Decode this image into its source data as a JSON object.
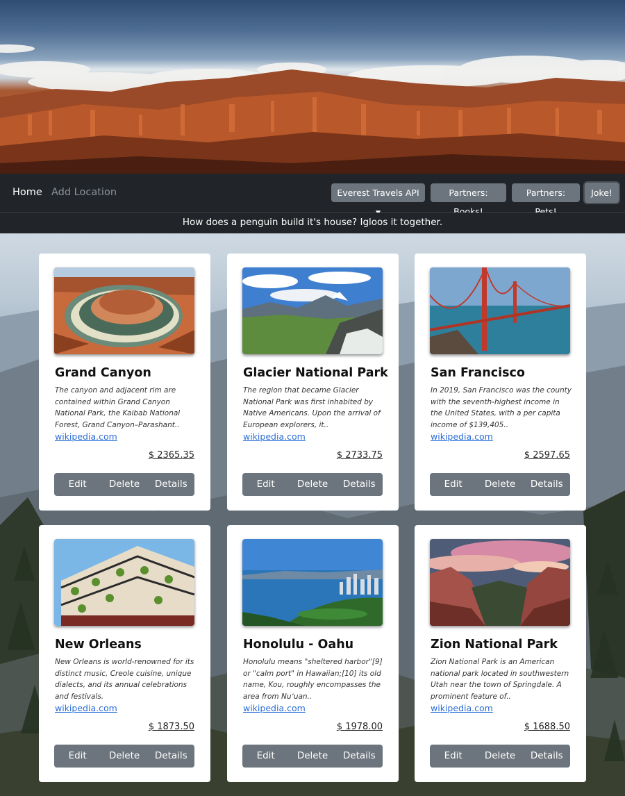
{
  "nav": {
    "home": "Home",
    "add_location": "Add Location",
    "buttons": {
      "api": "Everest Travels API",
      "books": "Partners: Books!",
      "pets": "Partners: Pets!",
      "joke": "Joke!"
    }
  },
  "joke": "How does a penguin build it's house? Igloos it together.",
  "actions": {
    "edit": "Edit",
    "delete": "Delete",
    "details": "Details"
  },
  "cards": [
    {
      "title": "Grand Canyon",
      "description": "The canyon and adjacent rim are contained within Grand Canyon National Park, the Kaibab National Forest, Grand Canyon–Parashant..",
      "link": "wikipedia.com",
      "price": "$ 2365.35"
    },
    {
      "title": "Glacier National Park",
      "description": "The region that became Glacier National Park was first inhabited by Native Americans. Upon the arrival of European explorers, it..",
      "link": "wikipedia.com",
      "price": "$ 2733.75"
    },
    {
      "title": "San Francisco",
      "description": "In 2019, San Francisco was the county with the seventh-highest income in the United States, with a per capita income of $139,405..",
      "link": "wikipedia.com",
      "price": "$ 2597.65"
    },
    {
      "title": "New Orleans",
      "description": "New Orleans is world-renowned for its distinct music, Creole cuisine, unique dialects, and its annual celebrations and festivals.",
      "link": "wikipedia.com",
      "price": "$ 1873.50"
    },
    {
      "title": "Honolulu - Oahu",
      "description": "Honolulu means \"sheltered harbor\"[9] or \"calm port\" in Hawaiian;[10] its old name, Kou, roughly encompasses the area from Nuʻuan..",
      "link": "wikipedia.com",
      "price": "$ 1978.00"
    },
    {
      "title": "Zion National Park",
      "description": "Zion National Park is an American national park located in southwestern Utah near the town of Springdale. A prominent feature of..",
      "link": "wikipedia.com",
      "price": "$ 1688.50"
    }
  ]
}
